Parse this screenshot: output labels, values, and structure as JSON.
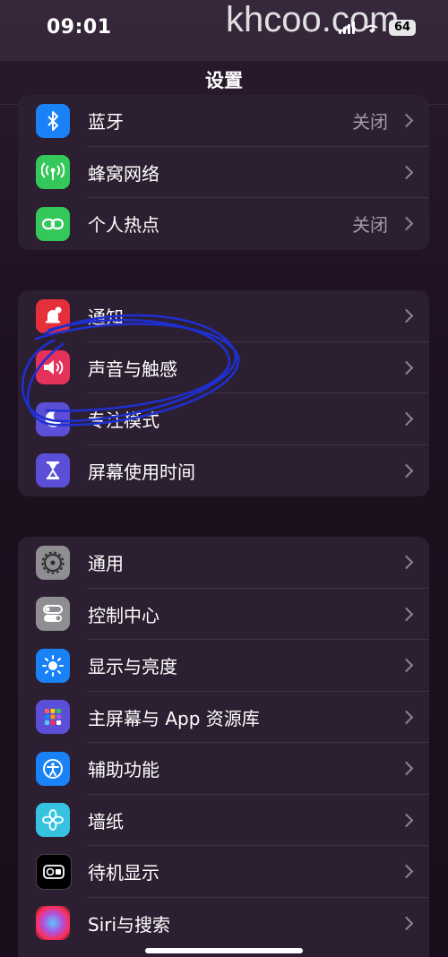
{
  "status_bar": {
    "time": "09:01",
    "watermark": "khcoo.com",
    "battery": "64"
  },
  "nav": {
    "title": "设置"
  },
  "groups": [
    {
      "items": [
        {
          "label": "蓝牙",
          "value": "关闭",
          "icon": "bluetooth-icon",
          "color": "#1a82f7"
        },
        {
          "label": "蜂窝网络",
          "value": "",
          "icon": "cellular-icon",
          "color": "#34c759"
        },
        {
          "label": "个人热点",
          "value": "关闭",
          "icon": "hotspot-icon",
          "color": "#34c759"
        }
      ]
    },
    {
      "items": [
        {
          "label": "通知",
          "icon": "notification-bell-icon",
          "color": "#e5303c"
        },
        {
          "label": "声音与触感",
          "icon": "speaker-icon",
          "color": "#e5325a"
        },
        {
          "label": "专注模式",
          "icon": "moon-icon",
          "color": "#5a4fd6"
        },
        {
          "label": "屏幕使用时间",
          "icon": "hourglass-icon",
          "color": "#5a4fd6"
        }
      ]
    },
    {
      "items": [
        {
          "label": "通用",
          "icon": "gear-icon",
          "color": "#8e8e93"
        },
        {
          "label": "控制中心",
          "icon": "toggles-icon",
          "color": "#8e8e93"
        },
        {
          "label": "显示与亮度",
          "icon": "sun-icon",
          "color": "#1a82f7"
        },
        {
          "label": "主屏幕与 App 资源库",
          "icon": "app-grid-icon",
          "color": "#5a4fd6"
        },
        {
          "label": "辅助功能",
          "icon": "accessibility-icon",
          "color": "#1a82f7"
        },
        {
          "label": "墙纸",
          "icon": "flower-icon",
          "color": "#36c3e0"
        },
        {
          "label": "待机显示",
          "icon": "standby-icon",
          "color": "#000000"
        },
        {
          "label": "Siri与搜索",
          "icon": "siri-icon",
          "color": "#222222"
        }
      ]
    }
  ]
}
